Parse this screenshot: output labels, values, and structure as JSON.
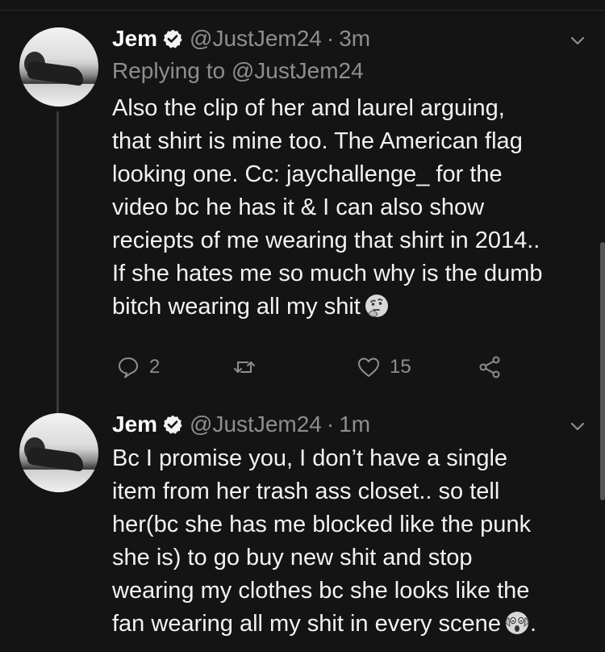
{
  "colors": {
    "background": "#141414",
    "text": "#f2f2f2",
    "muted": "#8e8e8e",
    "thread_line": "#3a3a3a"
  },
  "tweets": [
    {
      "name": "Jem",
      "handle": "@JustJem24",
      "separator": "·",
      "time": "3m",
      "replying_to": "Replying to @JustJem24",
      "lines": [
        "Also the clip of her and laurel arguing,",
        "that shirt is mine too. The American flag",
        "looking one. Cc: jaychallenge_ for the",
        "video bc he has it & I can also show",
        "reciepts of me wearing that shirt in 2014..",
        "If she hates me so much why is the dumb",
        "bitch wearing all my shit"
      ],
      "trailing_emoji": "thinking-face-emoji",
      "reply_count": "2",
      "retweet_count": "",
      "like_count": "15"
    },
    {
      "name": "Jem",
      "handle": "@JustJem24",
      "separator": "·",
      "time": "1m",
      "lines": [
        "Bc I promise you, I don’t have a single",
        "item from her trash ass closet.. so tell",
        "her(bc she has me blocked like the punk",
        "she is) to go buy new shit and stop",
        "wearing my clothes bc she looks like the",
        "fan wearing all my shit in every scene",
        "."
      ],
      "trailing_emoji": "screaming-face-emoji"
    }
  ]
}
